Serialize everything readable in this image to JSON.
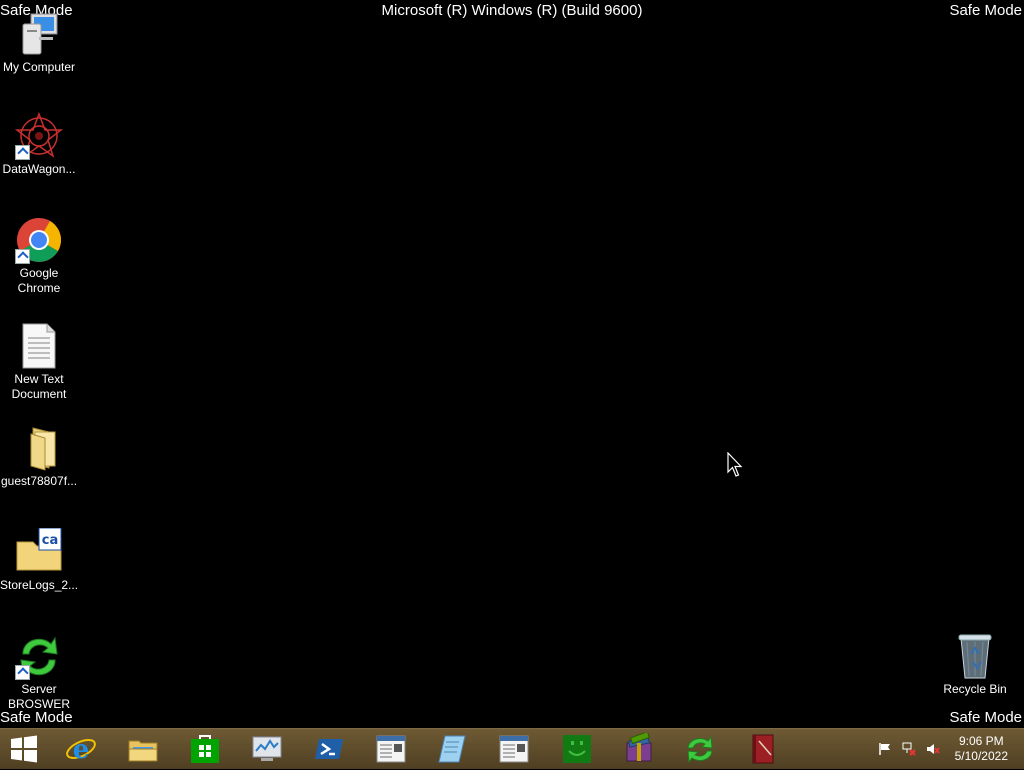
{
  "overlay": {
    "safe_mode": "Safe Mode",
    "build": "Microsoft (R) Windows (R) (Build 9600)"
  },
  "desktop": {
    "icons": [
      {
        "label": "My Computer",
        "icon": "computer-icon"
      },
      {
        "label": "DataWagon...",
        "icon": "datawagon-icon"
      },
      {
        "label": "Google Chrome",
        "icon": "chrome-icon"
      },
      {
        "label": "New Text Document",
        "icon": "text-document-icon"
      },
      {
        "label": "guest78807f...",
        "icon": "folder-icon"
      },
      {
        "label": "StoreLogs_2...",
        "icon": "storelogs-icon"
      },
      {
        "label": "Server BROSWER",
        "icon": "sync-icon"
      },
      {
        "label": "Recycle Bin",
        "icon": "recycle-bin-icon"
      }
    ]
  },
  "taskbar": {
    "buttons": [
      "start-icon",
      "internet-explorer-icon",
      "file-explorer-icon",
      "store-icon",
      "performance-monitor-icon",
      "powershell-icon",
      "document-window-icon",
      "notepad-icon",
      "document-window-icon",
      "smiley-icon",
      "archive-icon",
      "sync-icon",
      "book-icon"
    ],
    "tray": {
      "time": "9:06 PM",
      "date": "5/10/2022"
    }
  }
}
